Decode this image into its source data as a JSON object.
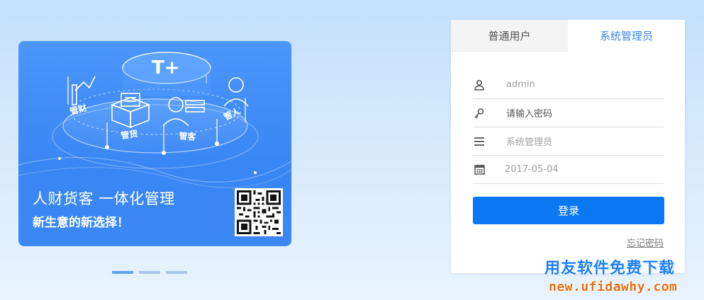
{
  "banner": {
    "title": "人财货客 一体化管理",
    "subtitle": "新生意的新选择！",
    "logo_text": "T+",
    "modules": [
      "管财",
      "管货",
      "管客",
      "管人"
    ],
    "qr_code": "qr-code-icon"
  },
  "carousel": {
    "count": 3,
    "active_index": 0
  },
  "login": {
    "tabs": [
      {
        "label": "普通用户",
        "active": false
      },
      {
        "label": "系统管理员",
        "active": true
      }
    ],
    "username": {
      "value": "admin",
      "icon": "user-icon"
    },
    "password": {
      "placeholder": "请输入密码",
      "icon": "key-icon"
    },
    "account": {
      "value": "系统管理员",
      "icon": "list-icon"
    },
    "date": {
      "value": "2017-05-04",
      "icon": "calendar-icon"
    },
    "submit_label": "登录",
    "forgot_label": "忘记密码"
  },
  "watermark": {
    "line1": "用友软件免费下载",
    "line2": "new.ufidawhy.com"
  },
  "colors": {
    "accent": "#0a78f2",
    "tab_active": "#3b86e6",
    "banner_bg": "#3d89f5",
    "watermark_blue": "#1e7ff5",
    "watermark_orange": "#e77011"
  }
}
